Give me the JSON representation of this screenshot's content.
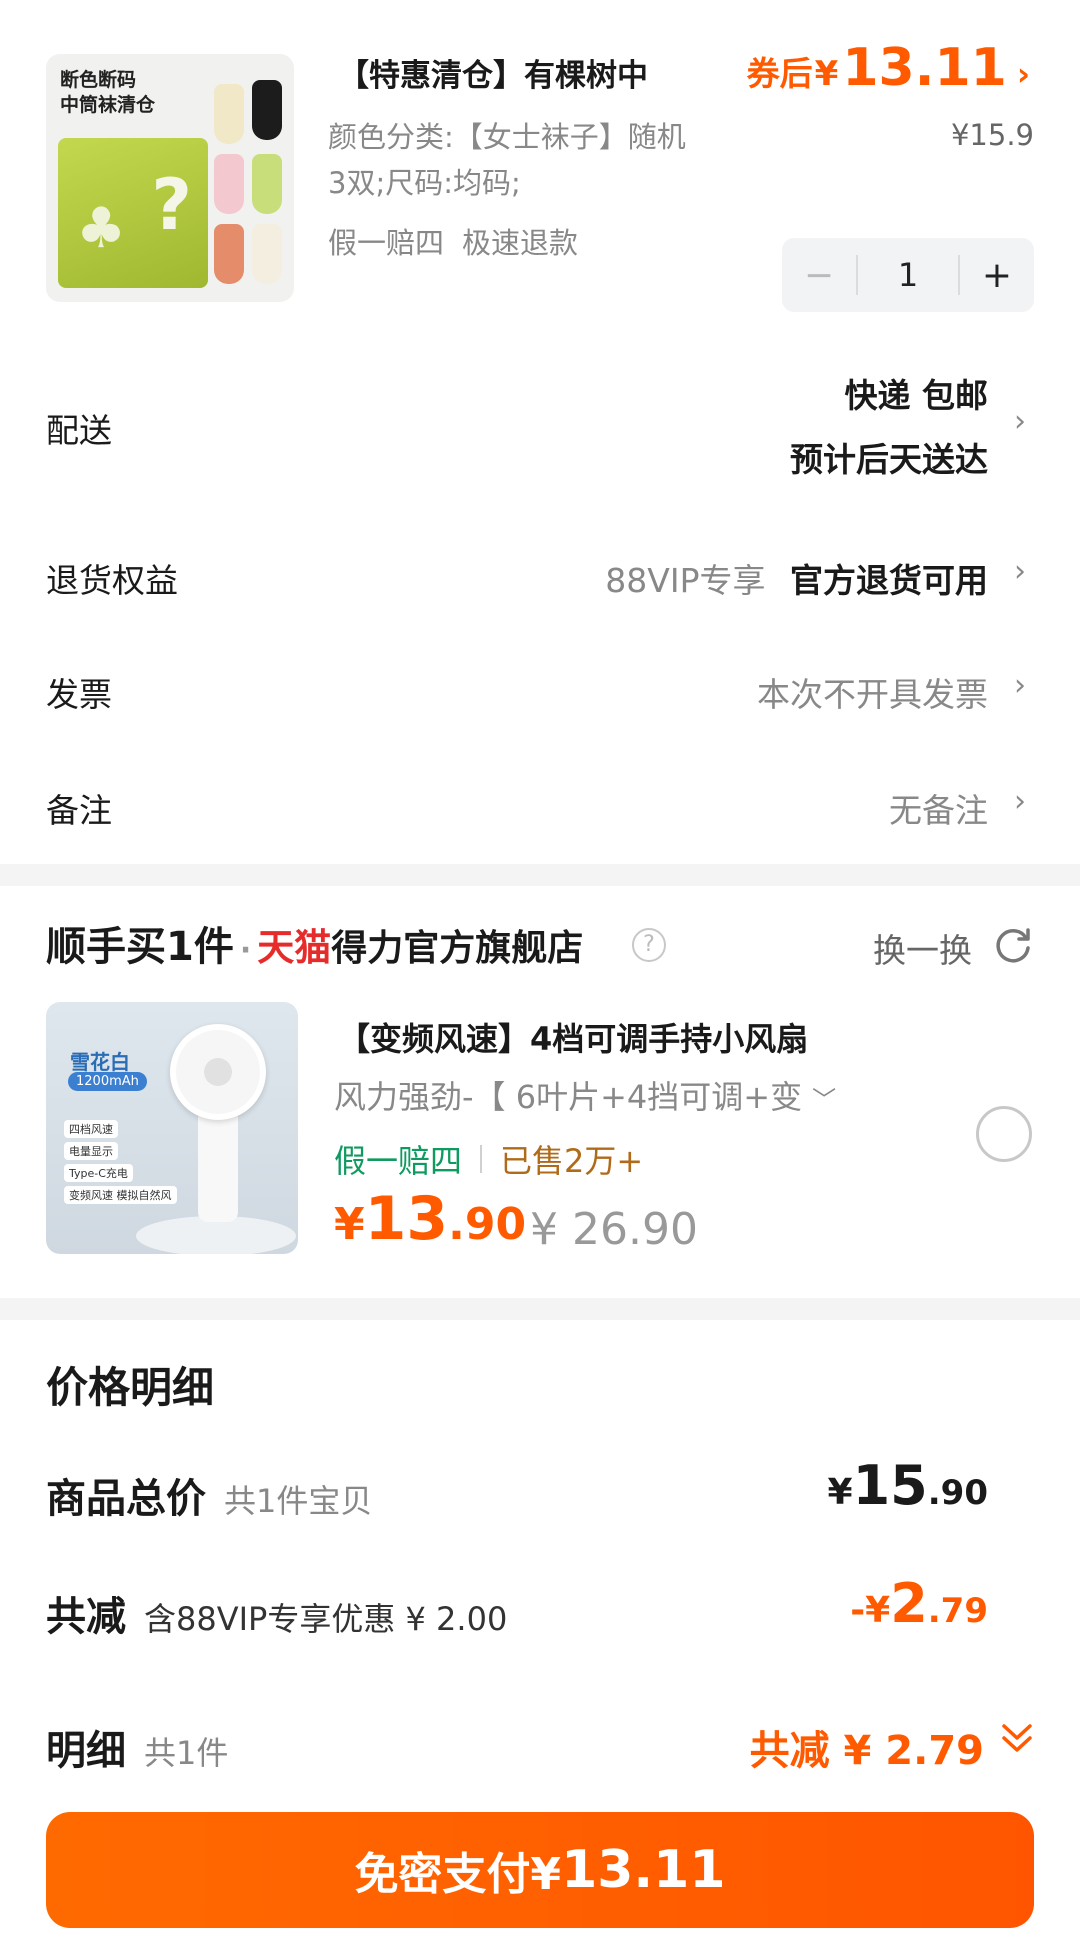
{
  "product": {
    "image_caption_line1": "断色断码",
    "image_caption_line2": "中筒袜清仓",
    "title": "【特惠清仓】有棵树中",
    "coupon_label": "券后",
    "coupon_currency": "¥",
    "coupon_price": "13.11",
    "original_price": "¥15.9",
    "spec_line1": "颜色分类:【女士袜子】随机",
    "spec_line2": "3双;尺码:均码;",
    "guarantee_1": "假一赔四",
    "guarantee_2": "极速退款",
    "quantity": "1",
    "minus": "−",
    "plus": "+"
  },
  "rows": {
    "delivery_label": "配送",
    "delivery_value1": "快递 包邮",
    "delivery_value2": "预计后天送达",
    "return_label": "退货权益",
    "return_vip": "88VIP专享",
    "return_value": "官方退货可用",
    "invoice_label": "发票",
    "invoice_value": "本次不开具发票",
    "note_label": "备注",
    "note_value": "无备注"
  },
  "bundle": {
    "brand": "顺手买1件",
    "dot": "·",
    "tmall": "天猫",
    "store": "得力官方旗舰店",
    "help": "?",
    "swap": "换一换",
    "img_tag1": "雪花白",
    "img_tag2": "1200mAh",
    "img_feat1": "四档风速",
    "img_feat2": "电量显示",
    "img_feat3": "Type-C充电",
    "img_feat4": "变频风速 模拟自然风",
    "title": "【变频风速】4档可调手持小风扇",
    "spec": "风力强劲-【 6叶片+4挡可调+变",
    "tag_green": "假一赔四",
    "tag_sold": "已售2万+",
    "price_cur": "¥",
    "price_int": "13",
    "price_dec": ".90",
    "original_price": "¥ 26.90"
  },
  "price_detail": {
    "title": "价格明细",
    "total_label": "商品总价",
    "total_sub": "共1件宝贝",
    "total_cur": "¥",
    "total_int": "15",
    "total_dec": ".90",
    "discount_label": "共减",
    "discount_sub": "含88VIP专享优惠 ¥ 2.00",
    "discount_cur": "-¥",
    "discount_int": "2",
    "discount_dec": ".79",
    "detail_label": "明细",
    "detail_sub": "共1件",
    "detail_sum": "共减 ¥ 2.79"
  },
  "pay": {
    "label": "免密支付¥",
    "amount": "13.11"
  },
  "colors": {
    "accent": "#ff5a00",
    "tmall_red": "#e62b2b",
    "green": "#0f9a5f",
    "brown": "#b06b1a"
  }
}
